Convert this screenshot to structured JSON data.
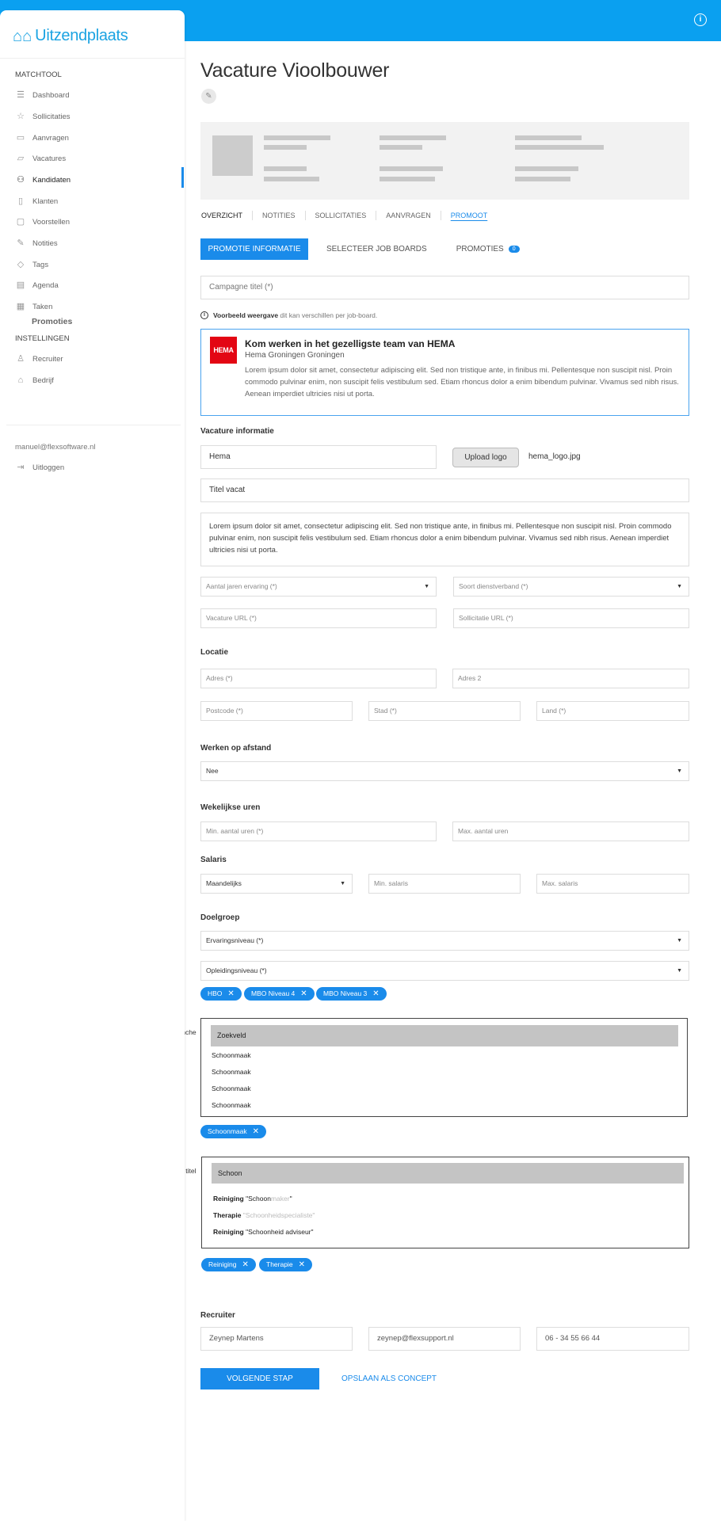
{
  "app": {
    "logo_text": "Uitzendplaats"
  },
  "sidebar": {
    "section1": "MATCHTOOL",
    "items": [
      {
        "label": "Dashboard",
        "icon": "list-icon"
      },
      {
        "label": "Sollicitaties",
        "icon": "star-icon"
      },
      {
        "label": "Aanvragen",
        "icon": "briefcase-icon"
      },
      {
        "label": "Vacatures",
        "icon": "folder-icon"
      },
      {
        "label": "Kandidaten",
        "icon": "users-icon"
      },
      {
        "label": "Klanten",
        "icon": "building-icon"
      },
      {
        "label": "Voorstellen",
        "icon": "chat-icon"
      },
      {
        "label": "Notities",
        "icon": "note-icon"
      },
      {
        "label": "Tags",
        "icon": "tag-icon"
      },
      {
        "label": "Agenda",
        "icon": "calendar-icon"
      },
      {
        "label": "Taken",
        "icon": "task-icon"
      }
    ],
    "sub_item": "Promoties",
    "section2": "INSTELLINGEN",
    "settings": [
      {
        "label": "Recruiter",
        "icon": "user-icon"
      },
      {
        "label": "Bedrijf",
        "icon": "home-icon"
      }
    ],
    "email": "manuel@flexsoftware.nl",
    "logout": "Uitloggen"
  },
  "page": {
    "title": "Vacature Vioolbouwer",
    "tabs": [
      "OVERZICHT",
      "NOTITIES",
      "SOLLICITATIES",
      "AANVRAGEN",
      "PROMOOT"
    ],
    "subtabs": {
      "active": "PROMOTIE INFORMATIE",
      "second": "SELECTEER JOB BOARDS",
      "third": "PROMOTIES",
      "third_badge": "0"
    },
    "campaign_placeholder": "Campagne titel (*)",
    "note_bold": "Voorbeeld weergave",
    "note_rest": "dit kan verschillen per job-board."
  },
  "preview": {
    "logo_text": "HEMA",
    "title": "Kom werken in het gezelligste team van HEMA",
    "subtitle": "Hema  Groningen  Groningen",
    "body": "Lorem ipsum dolor sit amet, consectetur adipiscing elit. Sed non tristique ante, in finibus mi. Pellentesque non suscipit nisl. Proin commodo pulvinar enim, non suscipit felis vestibulum sed. Etiam rhoncus dolor a enim bibendum pulvinar. Vivamus sed nibh risus. Aenean imperdiet ultricies nisi ut porta."
  },
  "vacature": {
    "heading": "Vacature informatie",
    "company": "Hema",
    "upload_label": "Upload logo",
    "filename": "hema_logo.jpg",
    "title_value": "Titel vacat",
    "description": "Lorem ipsum dolor sit amet, consectetur adipiscing elit. Sed non tristique ante, in finibus mi. Pellentesque non suscipit nisl. Proin commodo pulvinar enim, non suscipit felis vestibulum sed. Etiam rhoncus dolor a enim bibendum pulvinar. Vivamus sed nibh risus. Aenean imperdiet ultricies nisi ut porta.",
    "experience_placeholder": "Aantal jaren ervaring (*)",
    "contract_placeholder": "Soort dienstverband (*)",
    "vacancy_url": "Vacature URL (*)",
    "application_url": "Sollicitatie URL (*)"
  },
  "locatie": {
    "heading": "Locatie",
    "adres": "Adres (*)",
    "adres2": "Adres 2",
    "postcode": "Postcode (*)",
    "stad": "Stad (*)",
    "land": "Land (*)"
  },
  "remote": {
    "heading": "Werken op afstand",
    "value": "Nee"
  },
  "uren": {
    "heading": "Wekelijkse uren",
    "min": "Min. aantal uren (*)",
    "max": "Max. aantal uren"
  },
  "salaris": {
    "heading": "Salaris",
    "period": "Maandelijks",
    "min": "Min. salaris",
    "max": "Max. salaris"
  },
  "doelgroep": {
    "heading": "Doelgroep",
    "ervaring": "Ervaringsniveau (*)",
    "opleiding": "Opleidingsniveau (*)",
    "chips": [
      "HBO",
      "MBO Niveau 4",
      "MBO Niveau 3"
    ]
  },
  "branche": {
    "label": "Branche",
    "search": "Zoekveld",
    "options": [
      "Schoonmaak",
      "Schoonmaak",
      "Schoonmaak",
      "Schoonmaak"
    ],
    "chips": [
      "Schoonmaak"
    ]
  },
  "functie": {
    "label": "Functie titel",
    "search": "Schoon",
    "options": [
      {
        "bold": "Reiniging",
        "pre": " \"Schoon",
        "faint": "maker",
        "post": "\""
      },
      {
        "bold": "Therapie",
        "pre": " \"Schoon",
        "faint": "heidspecialiste",
        "post": "\""
      },
      {
        "bold": "Reiniging",
        "pre": " \"Schoonheid adviseur",
        "faint": "",
        "post": "\""
      }
    ],
    "chips": [
      "Reiniging",
      "Therapie"
    ]
  },
  "recruiter": {
    "heading": "Recruiter",
    "name": "Zeynep Martens",
    "email": "zeynep@flexsupport.nl",
    "phone": "06 - 34 55 66 44"
  },
  "actions": {
    "next": "VOLGENDE STAP",
    "save": "OPSLAAN ALS CONCEPT"
  }
}
